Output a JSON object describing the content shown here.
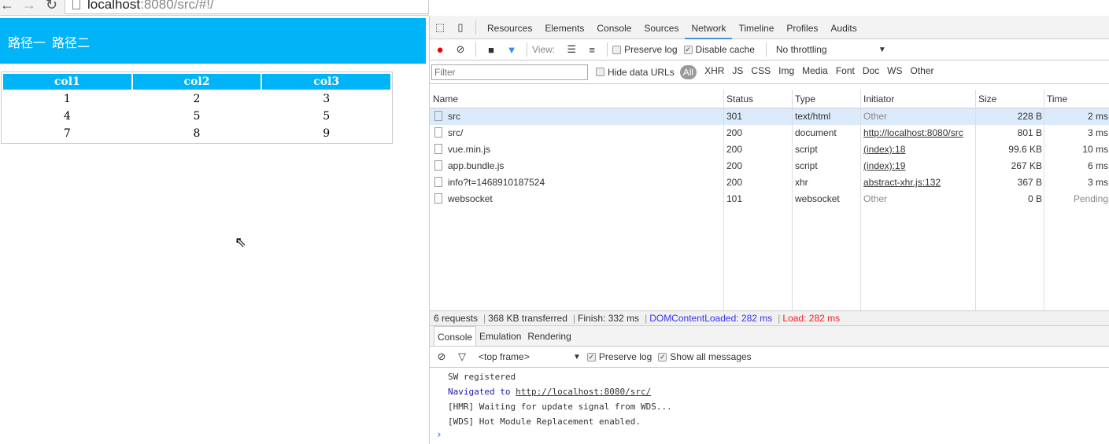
{
  "browser": {
    "url_host": "localhost",
    "url_rest": ":8080/src/#!/"
  },
  "page": {
    "links": [
      "路径一",
      "路径二"
    ],
    "table": {
      "headers": [
        "col1",
        "col2",
        "col3"
      ],
      "rows": [
        [
          "1",
          "2",
          "3"
        ],
        [
          "4",
          "5",
          "5"
        ],
        [
          "7",
          "8",
          "9"
        ]
      ]
    }
  },
  "devtools": {
    "tabs": [
      "Resources",
      "Elements",
      "Console",
      "Sources",
      "Network",
      "Timeline",
      "Profiles",
      "Audits"
    ],
    "active_tab": "Network",
    "toolbar": {
      "view_label": "View:",
      "preserve_log": "Preserve log",
      "disable_cache": "Disable cache",
      "throttling": "No throttling"
    },
    "filter": {
      "placeholder": "Filter",
      "hide_data_urls": "Hide data URLs",
      "types": [
        "All",
        "XHR",
        "JS",
        "CSS",
        "Img",
        "Media",
        "Font",
        "Doc",
        "WS",
        "Other"
      ]
    },
    "columns": [
      "Name",
      "Status",
      "Type",
      "Initiator",
      "Size",
      "Time"
    ],
    "requests": [
      {
        "name": "src",
        "status": "301",
        "type": "text/html",
        "initiator": "Other",
        "size": "228 B",
        "time": "2 ms"
      },
      {
        "name": "src/",
        "status": "200",
        "type": "document",
        "initiator": "http://localhost:8080/src",
        "size": "801 B",
        "time": "3 ms"
      },
      {
        "name": "vue.min.js",
        "status": "200",
        "type": "script",
        "initiator": "(index):18",
        "size": "99.6 KB",
        "time": "10 ms"
      },
      {
        "name": "app.bundle.js",
        "status": "200",
        "type": "script",
        "initiator": "(index):19",
        "size": "267 KB",
        "time": "6 ms"
      },
      {
        "name": "info?t=1468910187524",
        "status": "200",
        "type": "xhr",
        "initiator": "abstract-xhr.js:132",
        "size": "367 B",
        "time": "3 ms"
      },
      {
        "name": "websocket",
        "status": "101",
        "type": "websocket",
        "initiator": "Other",
        "size": "0 B",
        "time": "Pending"
      }
    ],
    "status": {
      "requests": "6 requests",
      "transferred": "368 KB transferred",
      "finish": "Finish: 332 ms",
      "dcl": "DOMContentLoaded: 282 ms",
      "load": "Load: 282 ms"
    },
    "drawer_tabs": [
      "Console",
      "Emulation",
      "Rendering"
    ],
    "console": {
      "frame": "<top frame>",
      "preserve_log": "Preserve log",
      "show_all": "Show all messages",
      "messages": [
        "SW registered",
        "Navigated to ",
        "http://localhost:8080/src/",
        "[HMR] Waiting for update signal from WDS...",
        "[WDS] Hot Module Replacement enabled."
      ],
      "prompt": "›"
    },
    "colors": {
      "accent": "#00b4f7",
      "dcl": "#3333ee",
      "load": "#ee2222"
    }
  }
}
